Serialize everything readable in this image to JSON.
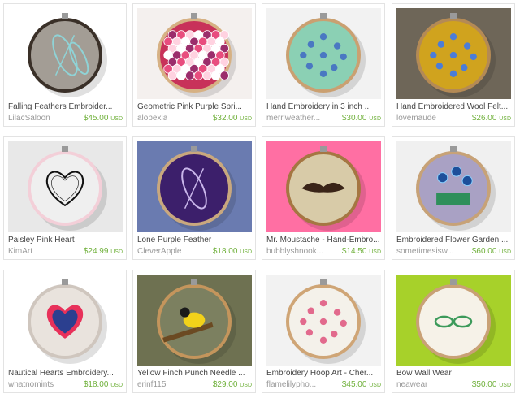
{
  "items": [
    {
      "title": "Falling Feathers Embroider...",
      "shop": "LilacSaloon",
      "price": "$45.00",
      "currency": "USD",
      "bg": "#ffffff",
      "hoop": "#3a3028",
      "fabric": "#a39d95",
      "motif": "feathers"
    },
    {
      "title": "Geometric Pink Purple Spri...",
      "shop": "alopexia",
      "price": "$32.00",
      "currency": "USD",
      "bg": "#f4f0ee",
      "hoop": "#d6b184",
      "fabric": "#c8325a",
      "motif": "scales"
    },
    {
      "title": "Hand Embroidery in 3 inch ...",
      "shop": "merriweather...",
      "price": "$30.00",
      "currency": "USD",
      "bg": "#f2f2f2",
      "hoop": "#caa071",
      "fabric": "#8bd0b4",
      "motif": "flowers"
    },
    {
      "title": "Hand Embroidered Wool Felt...",
      "shop": "lovemaude",
      "price": "$26.00",
      "currency": "USD",
      "bg": "#6e6658",
      "hoop": "#b48a55",
      "fabric": "#d0a31e",
      "motif": "dots"
    },
    {
      "title": "Paisley Pink Heart",
      "shop": "KimArt",
      "price": "$24.99",
      "currency": "USD",
      "bg": "#e8e8e8",
      "hoop": "#f3cfd8",
      "fabric": "#efefef",
      "motif": "heart-lace"
    },
    {
      "title": "Lone Purple Feather",
      "shop": "CleverApple",
      "price": "$18.00",
      "currency": "USD",
      "bg": "#6a7bb0",
      "hoop": "#c9a87e",
      "fabric": "#3c1f6b",
      "motif": "feather"
    },
    {
      "title": "Mr. Moustache - Hand-Embro...",
      "shop": "bubblyshnook...",
      "price": "$14.50",
      "currency": "USD",
      "bg": "#ff6fa3",
      "hoop": "#a57642",
      "fabric": "#d8cba8",
      "motif": "moustache"
    },
    {
      "title": "Embroidered Flower Garden ...",
      "shop": "sometimesisw...",
      "price": "$60.00",
      "currency": "USD",
      "bg": "#f0f0f0",
      "hoop": "#c7a277",
      "fabric": "#a9a1c4",
      "motif": "garden"
    },
    {
      "title": "Nautical Hearts Embroidery...",
      "shop": "whatnomints",
      "price": "$18.00",
      "currency": "USD",
      "bg": "#ffffff",
      "hoop": "#cfc6be",
      "fabric": "#e9e3dd",
      "motif": "hearts"
    },
    {
      "title": "Yellow Finch Punch Needle ...",
      "shop": "erinf115",
      "price": "$29.00",
      "currency": "USD",
      "bg": "#6e7151",
      "hoop": "#c4955c",
      "fabric": "#7c8060",
      "motif": "finch"
    },
    {
      "title": "Embroidery Hoop Art - Cher...",
      "shop": "flamelilypho...",
      "price": "$45.00",
      "currency": "USD",
      "bg": "#f2f2f2",
      "hoop": "#cfa576",
      "fabric": "#f4f1ea",
      "motif": "blossoms"
    },
    {
      "title": "Bow Wall Wear",
      "shop": "neawear",
      "price": "$50.00",
      "currency": "USD",
      "bg": "#a7d12a",
      "hoop": "#c9a176",
      "fabric": "#f6f2e8",
      "motif": "bow"
    }
  ]
}
